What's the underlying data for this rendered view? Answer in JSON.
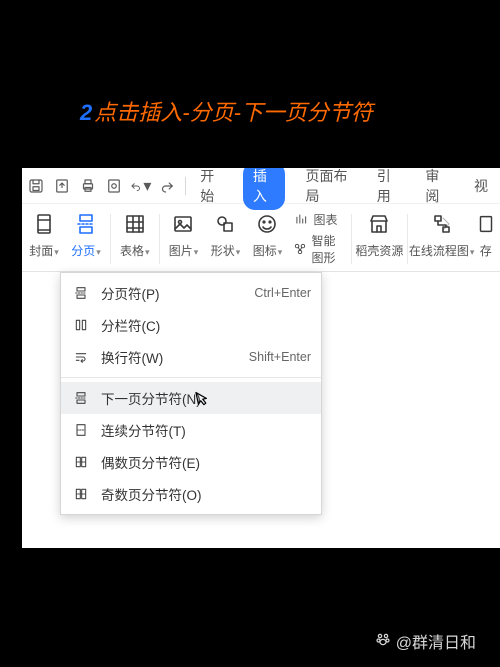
{
  "caption": {
    "step": "2",
    "text": "点击插入-分页-下一页分节符"
  },
  "qat_icons": [
    "save-icon",
    "export-icon",
    "print-icon",
    "preview-icon",
    "undo-icon",
    "redo-icon"
  ],
  "tabs": [
    {
      "label": "开始",
      "active": false
    },
    {
      "label": "插入",
      "active": true
    },
    {
      "label": "页面布局",
      "active": false
    },
    {
      "label": "引用",
      "active": false
    },
    {
      "label": "审阅",
      "active": false
    },
    {
      "label": "视",
      "active": false
    }
  ],
  "ribbon": {
    "groups": [
      {
        "name": "page",
        "label": "封面",
        "dropdown": true
      },
      {
        "name": "page-break",
        "label": "分页",
        "dropdown": true,
        "active": true
      },
      {
        "name": "table",
        "label": "表格",
        "dropdown": true
      },
      {
        "name": "picture",
        "label": "图片",
        "dropdown": true
      },
      {
        "name": "shape",
        "label": "形状",
        "dropdown": true
      },
      {
        "name": "icon",
        "label": "图标",
        "dropdown": true
      }
    ],
    "smart": {
      "chart_label": "图表",
      "smart_label": "智能图形"
    },
    "resource": {
      "label": "稻壳资源"
    },
    "flow": {
      "label": "在线流程图",
      "dropdown": true
    },
    "more": {
      "label": "存"
    }
  },
  "dropdown": {
    "items": [
      {
        "icon": "page-break-icon",
        "label": "分页符(P)",
        "shortcut": "Ctrl+Enter"
      },
      {
        "icon": "column-break-icon",
        "label": "分栏符(C)",
        "shortcut": ""
      },
      {
        "icon": "text-wrap-icon",
        "label": "换行符(W)",
        "shortcut": "Shift+Enter"
      },
      {
        "divider": true
      },
      {
        "icon": "next-page-section-icon",
        "label": "下一页分节符(N)",
        "shortcut": "",
        "hovered": true
      },
      {
        "icon": "continuous-section-icon",
        "label": "连续分节符(T)",
        "shortcut": ""
      },
      {
        "icon": "even-page-section-icon",
        "label": "偶数页分节符(E)",
        "shortcut": ""
      },
      {
        "icon": "odd-page-section-icon",
        "label": "奇数页分节符(O)",
        "shortcut": ""
      }
    ]
  },
  "watermark": {
    "handle": "@群清日和"
  }
}
